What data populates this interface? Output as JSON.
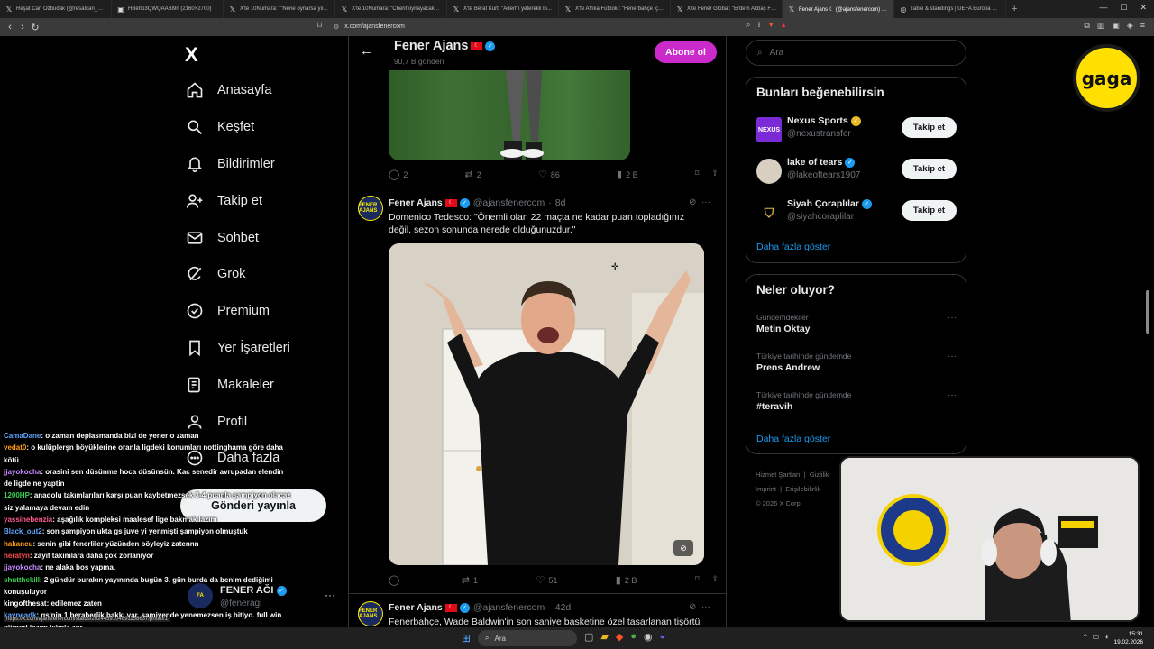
{
  "browser": {
    "tabs": [
      {
        "title": "Reşat Can Özbudak (@resatcan_ozb...",
        "icon": "x-icon",
        "active": false
      },
      {
        "title": "HBefIo3QWQAABl9n (2160×2700)",
        "icon": "image-icon",
        "active": false
      },
      {
        "title": "X'te 10Numara: \"\"Nene oynarsa yıl...",
        "icon": "x-icon",
        "active": false
      },
      {
        "title": "X'te 10Numara: \"Cherif oynayacak m...",
        "icon": "x-icon",
        "active": false
      },
      {
        "title": "X'te Berat Kurt: \"Adem'i yeterekli bi...",
        "icon": "x-icon",
        "active": false
      },
      {
        "title": "X'te Afrika Futbolu: \"Fenerbahçe için...",
        "icon": "x-icon",
        "active": false
      },
      {
        "title": "X'te Fener Global: \"Erdem Akbaş Fen...",
        "icon": "x-icon",
        "active": false
      },
      {
        "title": "Fener Ajans ☾ (@ajansfenercom) / X",
        "icon": "x-icon",
        "active": true
      },
      {
        "title": "Table & standings | UEFA Europa Lea...",
        "icon": "uefa-icon",
        "active": false
      }
    ],
    "url": "x.com/ajansfenercom"
  },
  "left_nav": {
    "logo": "X",
    "items": [
      {
        "label": "Anasayfa",
        "icon": "home-icon"
      },
      {
        "label": "Keşfet",
        "icon": "search-icon"
      },
      {
        "label": "Bildirimler",
        "icon": "bell-icon"
      },
      {
        "label": "Takip et",
        "icon": "add-user-icon"
      },
      {
        "label": "Sohbet",
        "icon": "mail-icon"
      },
      {
        "label": "Grok",
        "icon": "grok-icon"
      },
      {
        "label": "Premium",
        "icon": "verified-badge-icon"
      },
      {
        "label": "Yer İşaretleri",
        "icon": "bookmark-icon"
      },
      {
        "label": "Makaleler",
        "icon": "article-icon"
      },
      {
        "label": "Profil",
        "icon": "user-icon"
      },
      {
        "label": "Daha fazla",
        "icon": "more-circle-icon"
      }
    ],
    "post_button": "Gönderi yayınla",
    "account": {
      "name": "FENER AĞI",
      "handle": "@feneragi"
    }
  },
  "chat": [
    {
      "user": "CamaDane",
      "color": "#5fa8ff",
      "text": "o zaman deplasmanda bizi de yener o zaman"
    },
    {
      "user": "vedat0",
      "color": "#ff9f1a",
      "text": "o kulüplerşn böyüklerine oranla ligdeki konumları nottinghama göre daha kötü"
    },
    {
      "user": "jjayokocha",
      "color": "#c78bff",
      "text": "orasini sen düsünme hoca düsünsün. Kac senedir avrupadan elendin de ligde ne yaptin"
    },
    {
      "user": "1200HP",
      "color": "#39d353",
      "text": "anadolu takımlarıları karşı puan kaybetmezsek 3-4 puanla şampiyon olacaz siz yalamaya devam edin"
    },
    {
      "user": "yassinebenzia",
      "color": "#ff5a8a",
      "text": "aşağılık kompleksi maalesef lige bakmak lazım"
    },
    {
      "user": "Black_out2",
      "color": "#5fa8ff",
      "text": "son şampiyonlukta gs juve yi yenmişti şampiyon olmuştuk"
    },
    {
      "user": "hakancu",
      "color": "#ff9f1a",
      "text": "senin gibi fenerliler yüzünden böyleyiz zatennn"
    },
    {
      "user": "heratyn",
      "color": "#ff4d4d",
      "text": "zayıf takımlara daha çok zorlanıyor"
    },
    {
      "user": "jjayokocha",
      "color": "#c78bff",
      "text": "ne alaka bos yapma."
    },
    {
      "user": "shutthekill",
      "color": "#39d353",
      "text": "2 gündür burakın yayınında bugün 3. gün burda da benim dediğimi konuşuluyor"
    },
    {
      "user": "kingofthesat",
      "color": "#ffffff",
      "text": "edilemez zaten"
    },
    {
      "user": "kaypeadk",
      "color": "#5fa8ff",
      "text": "gs'nin 1 beraberlik hakkı var. samiyende yenemezsen iş bitiyo. full win gitmeri lazım işimiz zor"
    }
  ],
  "status_url": "https://x.com/ajansfenercom/status/20244591048911586​37/photo/1",
  "profile_header": {
    "name": "Fener Ajans",
    "flag": "☾",
    "posts": "90,7 B gönderi",
    "subscribe": "Abone ol"
  },
  "post1_actions": {
    "replies": "2",
    "reposts": "2",
    "likes": "86",
    "views": "2 B"
  },
  "post2": {
    "name": "Fener Ajans",
    "handle": "@ajansfenercom",
    "time": "8d",
    "text": "Domenico Tedesco: \"Önemli olan 22 maçta ne kadar puan topladığınız değil, sezon sonunda nerede olduğunuzdur.\"",
    "actions": {
      "replies": "",
      "reposts": "1",
      "likes": "51",
      "views": "2 B"
    }
  },
  "post3": {
    "name": "Fener Ajans",
    "handle": "@ajansfenercom",
    "time": "42d",
    "text": "Fenerbahçe, Wade Baldwin'in son saniye basketine özel tasarlanan tişörtü"
  },
  "avatar_text": "FENER AJANS",
  "search": {
    "placeholder": "Ara"
  },
  "suggestions": {
    "title": "Bunları beğenebilirsin",
    "items": [
      {
        "name": "Nexus Sports",
        "handle": "@nexustransfer",
        "badge": "gold",
        "follow": "Takip et"
      },
      {
        "name": "lake of tears",
        "handle": "@lakeoftears1907",
        "badge": "blue",
        "follow": "Takip et"
      },
      {
        "name": "Siyah Çoraplılar",
        "handle": "@siyahcoraplilar",
        "badge": "blue",
        "follow": "Takip et"
      }
    ],
    "show_more": "Daha fazla göster",
    "avatar_nexus": "NEXUS"
  },
  "trends": {
    "title": "Neler oluyor?",
    "items": [
      {
        "context": "Gündemdekiler",
        "name": "Metin Oktay"
      },
      {
        "context": "Türkiye tarihinde gündemde",
        "name": "Prens Andrew"
      },
      {
        "context": "Türkiye tarihinde gündemde",
        "name": "#teravih"
      }
    ],
    "show_more": "Daha fazla göster"
  },
  "footer": {
    "links": [
      "Hizmet Şartları",
      "Gizlilik",
      "Imprint",
      "Erişilebilirlik"
    ],
    "copyright": "© 2026 X Corp."
  },
  "overlay": {
    "logo": "gaga"
  },
  "taskbar": {
    "search": "Ara",
    "time": "15:31",
    "date": "19.02.2026"
  },
  "colors": {
    "accent": "#1d9bf0",
    "subscribe": "#c92ac9",
    "background": "#000000"
  }
}
